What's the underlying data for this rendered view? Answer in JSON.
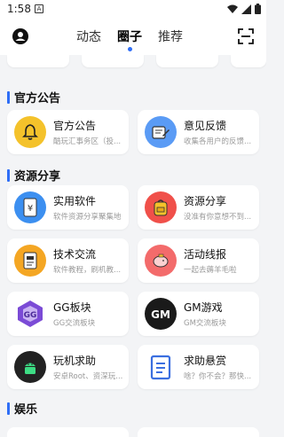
{
  "status": {
    "time": "1:58",
    "notif": "A"
  },
  "header": {
    "tabs": [
      {
        "label": "动态",
        "active": false
      },
      {
        "label": "圈子",
        "active": true
      },
      {
        "label": "推荐",
        "active": false
      }
    ]
  },
  "sections": [
    {
      "title": "官方公告",
      "cards": [
        {
          "title": "官方公告",
          "sub": "酷玩汇事务区（投...",
          "icon": "bell-icon",
          "color": "#f4c22b"
        },
        {
          "title": "意见反馈",
          "sub": "收集各用户的反馈...",
          "icon": "feedback-icon",
          "color": "#5a9bf5"
        }
      ]
    },
    {
      "title": "资源分享",
      "cards": [
        {
          "title": "实用软件",
          "sub": "软件资源分享聚集地",
          "icon": "software-icon",
          "color": "#3c8ff0"
        },
        {
          "title": "资源分享",
          "sub": "没准有你意想不到...",
          "icon": "backpack-icon",
          "color": "#f0504a"
        },
        {
          "title": "技术交流",
          "sub": "软件教程，刷机教...",
          "icon": "document-icon",
          "color": "#f4a623"
        },
        {
          "title": "活动线报",
          "sub": "一起去薅羊毛啦",
          "icon": "piggy-bank-icon",
          "color": "#f36b6b"
        },
        {
          "title": "GG板块",
          "sub": "GG交流板块",
          "icon": "gg-logo-icon",
          "color": "#7b4bd6"
        },
        {
          "title": "GM游戏",
          "sub": "GM交流板块",
          "icon": "gm-logo-icon",
          "color": "#1a1a1a"
        },
        {
          "title": "玩机求助",
          "sub": "安卓Root、资深玩...",
          "icon": "android-icon",
          "color": "#222222"
        },
        {
          "title": "求助悬赏",
          "sub": "啥？你不会？那快...",
          "icon": "list-icon",
          "color": "#3b6fe0"
        }
      ]
    },
    {
      "title": "娱乐",
      "cards": []
    }
  ],
  "colors": {
    "accent": "#2f6ef6",
    "background": "#f3f4f6"
  }
}
